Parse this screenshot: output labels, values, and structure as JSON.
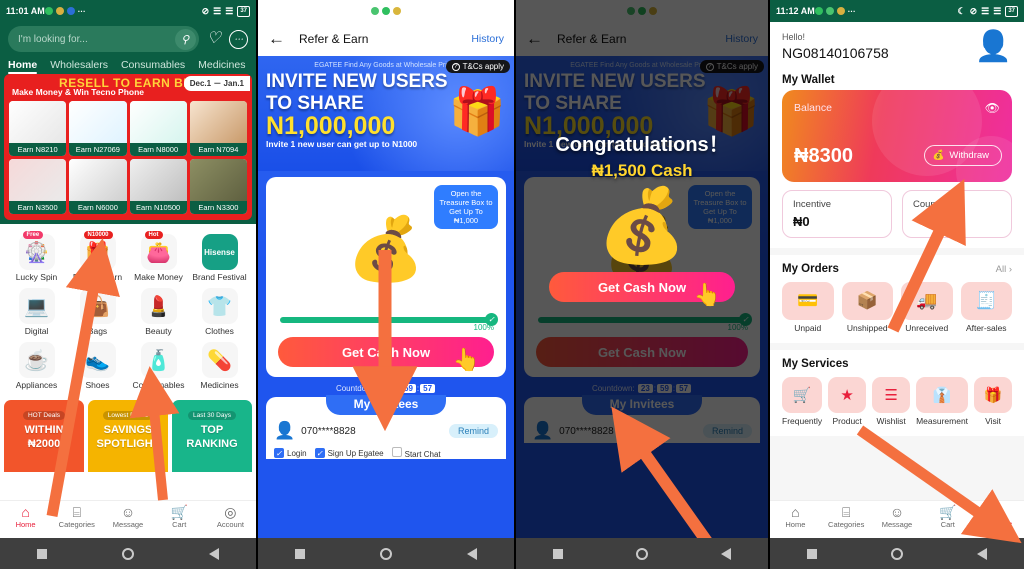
{
  "panel1": {
    "status": {
      "time": "11:01 AM",
      "battery": "37"
    },
    "search": {
      "placeholder": "I'm looking for...",
      "icon": "search-icon"
    },
    "header_icons": [
      "heart-icon",
      "chat-icon"
    ],
    "tabs": [
      {
        "label": "Home",
        "active": true
      },
      {
        "label": "Wholesalers",
        "active": false
      },
      {
        "label": "Consumables",
        "active": false
      },
      {
        "label": "Medicines",
        "active": false
      }
    ],
    "promo": {
      "title": "RESELL TO EARN BIG",
      "subtitle": "Make Money & Win Tecno Phone",
      "date_range": "Dec.1 －  Jan.1",
      "products": [
        {
          "earn": "Earn N8210"
        },
        {
          "earn": "Earn N27069"
        },
        {
          "earn": "Earn N8000"
        },
        {
          "earn": "Earn N7094"
        },
        {
          "earn": "Earn N3500"
        },
        {
          "earn": "Earn N6000"
        },
        {
          "earn": "Earn N10500"
        },
        {
          "earn": "Earn N3300"
        }
      ]
    },
    "categories": [
      {
        "label": "Lucky Spin",
        "icon": "lucky-spin-icon",
        "glyph": "🎡",
        "badge": "Free",
        "badge_color": "bd-pink"
      },
      {
        "label": "Refer & Earn",
        "icon": "refer-earn-icon",
        "glyph": "🎁",
        "badge": "N10000",
        "badge_color": "bd-red"
      },
      {
        "label": "Make Money",
        "icon": "make-money-icon",
        "glyph": "👛",
        "badge": "Hot",
        "badge_color": "bd-red"
      },
      {
        "label": "Brand Festival",
        "icon": "brand-festival-icon",
        "glyph": "Hisense",
        "badge": "",
        "badge_color": ""
      },
      {
        "label": "Digital",
        "icon": "digital-icon",
        "glyph": "💻",
        "badge": "",
        "badge_color": ""
      },
      {
        "label": "Bags",
        "icon": "bags-icon",
        "glyph": "👜",
        "badge": "",
        "badge_color": ""
      },
      {
        "label": "Beauty",
        "icon": "beauty-icon",
        "glyph": "💄",
        "badge": "",
        "badge_color": ""
      },
      {
        "label": "Clothes",
        "icon": "clothes-icon",
        "glyph": "👕",
        "badge": "",
        "badge_color": ""
      },
      {
        "label": "Appliances",
        "icon": "appliances-icon",
        "glyph": "☕",
        "badge": "",
        "badge_color": ""
      },
      {
        "label": "Shoes",
        "icon": "shoes-icon",
        "glyph": "👟",
        "badge": "",
        "badge_color": ""
      },
      {
        "label": "Consumables",
        "icon": "consumables-icon",
        "glyph": "🧴",
        "badge": "",
        "badge_color": ""
      },
      {
        "label": "Medicines",
        "icon": "medicines-icon",
        "glyph": "💊",
        "badge": "",
        "badge_color": ""
      }
    ],
    "banners": [
      {
        "tag": "HOT Deals",
        "title1": "WITHIN",
        "title2": "₦2000"
      },
      {
        "tag": "Lowest Prices",
        "title1": "SAVINGS",
        "title2": "SPOTLIGHT"
      },
      {
        "tag": "Last 30 Days",
        "title1": "TOP",
        "title2": "RANKING"
      }
    ],
    "tabbar": [
      {
        "label": "Home",
        "icon": "home-icon",
        "glyph": "⌂",
        "active": true
      },
      {
        "label": "Categories",
        "icon": "categories-icon",
        "glyph": "⌸",
        "active": false
      },
      {
        "label": "Message",
        "icon": "message-icon",
        "glyph": "☺",
        "active": false
      },
      {
        "label": "Cart",
        "icon": "cart-icon",
        "glyph": "🛒",
        "active": false
      },
      {
        "label": "Account",
        "icon": "account-icon",
        "glyph": "◎",
        "active": false
      }
    ]
  },
  "panel2": {
    "header": {
      "title": "Refer & Earn",
      "history": "History",
      "back_icon": "back-arrow-icon"
    },
    "hero": {
      "kicker": "EGATEE Find Any Goods at Wholesale Prices",
      "tcs": "T&Cs apply",
      "line1": "INVITE NEW USERS",
      "line2": "TO SHARE",
      "amount": "N1,000,000",
      "line3": "Invite 1 new user can get up to N1000"
    },
    "treasure_chip": "Open the Treasure Box to Get Up To ₦1,000",
    "progress": {
      "percent": "100%",
      "value": 100
    },
    "cta": "Get Cash Now",
    "countdown": {
      "label": "Countdown:",
      "h": "23",
      "m": "59",
      "s": "57"
    },
    "invitees": {
      "title": "My Invitees",
      "rows": [
        {
          "phone": "070****8828",
          "remind": "Remind",
          "checks": [
            {
              "label": "Login",
              "checked": true
            },
            {
              "label": "Sign Up Egatee",
              "checked": true
            },
            {
              "label": "Start Chat",
              "checked": false
            }
          ]
        }
      ]
    }
  },
  "panel3": {
    "dialog": {
      "title": "Congratulations！",
      "amount": "₦1,500 Cash",
      "button": "Get Cash Now"
    }
  },
  "panel4": {
    "status": {
      "time": "11:12 AM",
      "battery": "37"
    },
    "greeting": "Hello!",
    "user_id": "NG08140106758",
    "wallet": {
      "section_title": "My Wallet",
      "balance_label": "Balance",
      "balance": "₦8300",
      "withdraw": "Withdraw",
      "eye_icon": "eye-icon",
      "incentive_label": "Incentive",
      "incentive_value": "₦0",
      "coupons_label": "Coupons"
    },
    "orders": {
      "title": "My Orders",
      "all": "All ›",
      "items": [
        {
          "label": "Unpaid",
          "icon": "credit-card-icon",
          "glyph": "💳"
        },
        {
          "label": "Unshipped",
          "icon": "box-down-icon",
          "glyph": "📦"
        },
        {
          "label": "Unreceived",
          "icon": "truck-icon",
          "glyph": "🚚"
        },
        {
          "label": "After-sales",
          "icon": "after-sales-icon",
          "glyph": "🧾"
        }
      ]
    },
    "services": {
      "title": "My Services",
      "items": [
        {
          "label": "Frequently",
          "icon": "cart-check-icon",
          "glyph": "🛒"
        },
        {
          "label": "Product",
          "icon": "star-icon",
          "glyph": "★"
        },
        {
          "label": "Wishlist",
          "icon": "wishlist-icon",
          "glyph": "☰"
        },
        {
          "label": "Measurement",
          "icon": "shirt-icon",
          "glyph": "👔"
        },
        {
          "label": "Visit",
          "icon": "visit-icon",
          "glyph": "🎁"
        }
      ]
    },
    "tabbar": [
      {
        "label": "Home",
        "icon": "home-icon",
        "glyph": "⌂",
        "active": false
      },
      {
        "label": "Categories",
        "icon": "categories-icon",
        "glyph": "⌸",
        "active": false
      },
      {
        "label": "Message",
        "icon": "message-icon",
        "glyph": "☺",
        "active": false
      },
      {
        "label": "Cart",
        "icon": "cart-icon",
        "glyph": "🛒",
        "active": false
      },
      {
        "label": "Account",
        "icon": "account-icon",
        "glyph": "📍",
        "active": true
      }
    ]
  },
  "colors": {
    "brand_green": "#0b5e43",
    "accent_red": "#e8203c",
    "blue": "#1f55ee",
    "arrow": "#f4703f"
  }
}
